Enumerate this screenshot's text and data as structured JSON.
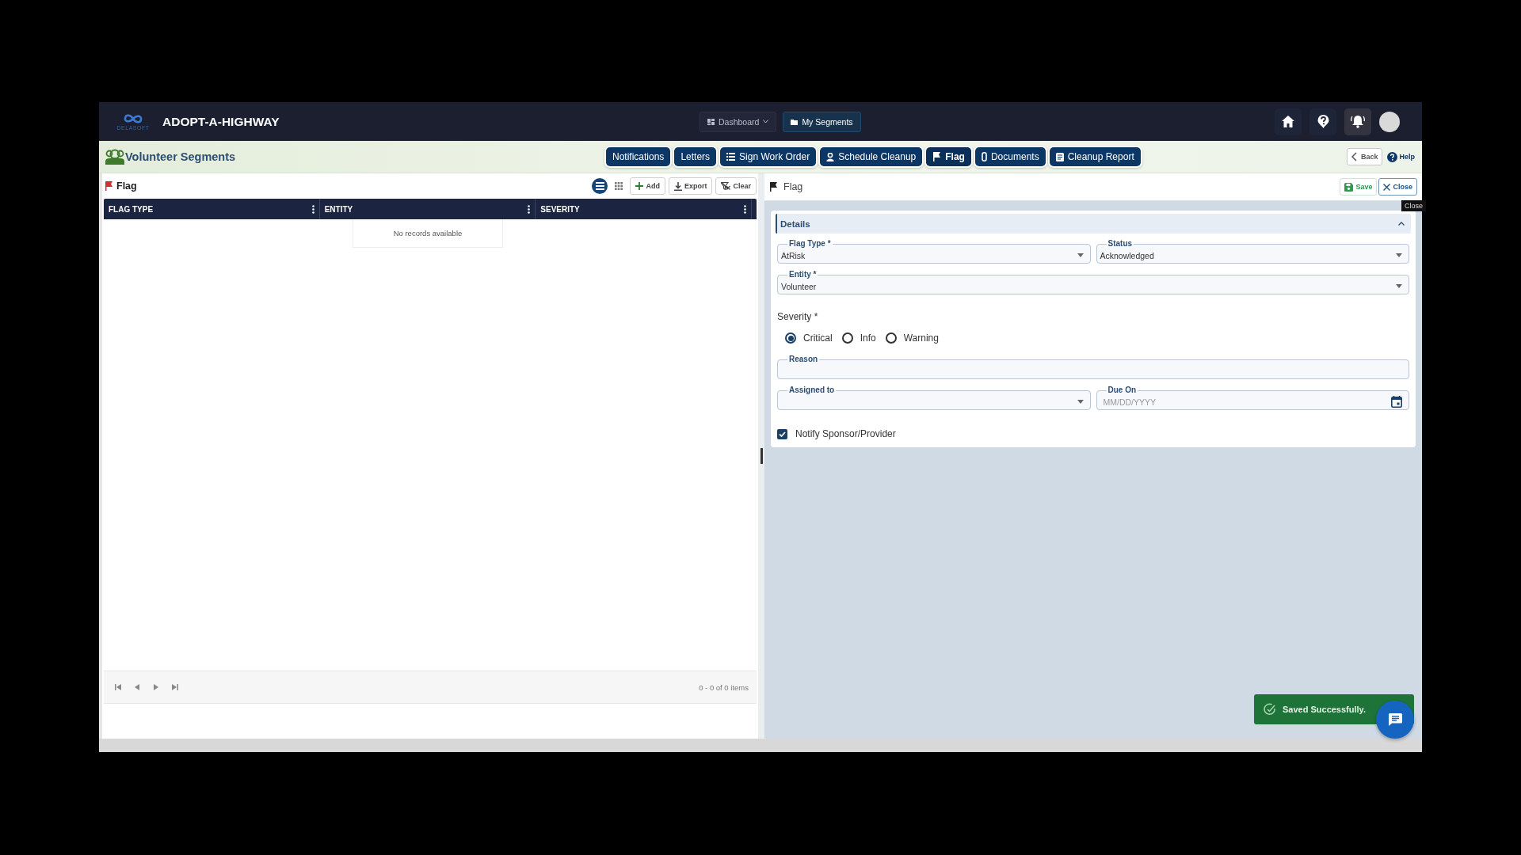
{
  "app": {
    "logo_text": "DELASOFT",
    "title": "ADOPT-A-HIGHWAY",
    "nav": [
      {
        "label": "Dashboard",
        "kind": "dropdown",
        "selected": false
      },
      {
        "label": "My Segments",
        "kind": "link",
        "selected": true
      }
    ]
  },
  "page": {
    "title": "Volunteer Segments",
    "tabs": [
      {
        "label": "Notifications",
        "selected": false
      },
      {
        "label": "Letters",
        "selected": false
      },
      {
        "label": "Sign Work Order",
        "selected": false
      },
      {
        "label": "Schedule Cleanup",
        "selected": false
      },
      {
        "label": "Flag",
        "selected": true
      },
      {
        "label": "Documents",
        "selected": false
      },
      {
        "label": "Cleanup Report",
        "selected": false
      }
    ],
    "back": "Back",
    "help": "Help"
  },
  "list_panel": {
    "title": "Flag",
    "view_modes": [
      {
        "kind": "list",
        "selected": true
      },
      {
        "kind": "grid",
        "selected": false
      }
    ],
    "actions": [
      {
        "label": "Add",
        "kind": "add"
      },
      {
        "label": "Export",
        "kind": "export"
      },
      {
        "label": "Clear",
        "kind": "clear"
      }
    ],
    "columns": [
      "FLAG TYPE",
      "ENTITY",
      "SEVERITY"
    ],
    "empty_message": "No records available",
    "pager": "0 - 0 of 0 items"
  },
  "form": {
    "title": "Flag",
    "save": "Save",
    "close": "Close",
    "tooltip": "Close",
    "section": {
      "title": "Details",
      "expanded": true
    },
    "rows": [
      {
        "fields": [
          {
            "kind": "select",
            "label": "Flag Type *",
            "value": "AtRisk"
          },
          {
            "kind": "select",
            "label": "Status",
            "value": "Acknowledged"
          }
        ]
      },
      {
        "fields": [
          {
            "kind": "select",
            "label": "Entity *",
            "value": "Volunteer"
          }
        ]
      },
      {
        "fields": [
          {
            "kind": "radio",
            "label": "Severity *",
            "options": [
              {
                "label": "Critical",
                "selected": true
              },
              {
                "label": "Info",
                "selected": false
              },
              {
                "label": "Warning",
                "selected": false
              }
            ]
          }
        ]
      },
      {
        "fields": [
          {
            "kind": "text",
            "label": "Reason"
          }
        ]
      },
      {
        "fields": [
          {
            "kind": "select",
            "label": "Assigned to"
          },
          {
            "kind": "date",
            "label": "Due On",
            "placeholder": "MM/DD/YYYY"
          }
        ]
      },
      {
        "fields": [
          {
            "kind": "checkbox",
            "label": "Notify Sponsor/Provider",
            "checked": true
          }
        ]
      }
    ]
  },
  "toast": {
    "message": "Saved Successfully."
  }
}
